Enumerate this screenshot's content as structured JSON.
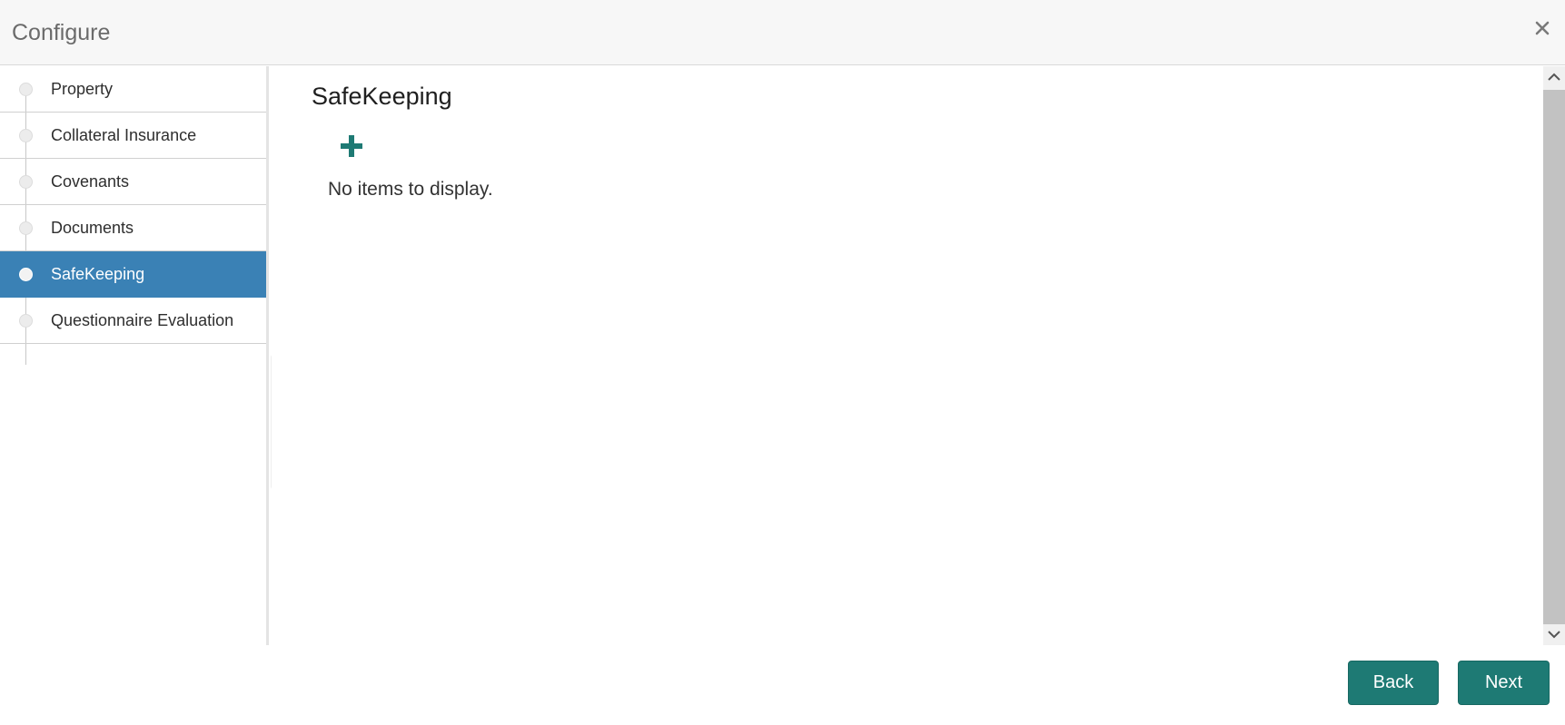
{
  "header": {
    "title": "Configure",
    "close_icon": "close-icon"
  },
  "sidebar": {
    "items": [
      {
        "label": "Property",
        "active": false
      },
      {
        "label": "Collateral Insurance",
        "active": false
      },
      {
        "label": "Covenants",
        "active": false
      },
      {
        "label": "Documents",
        "active": false
      },
      {
        "label": "SafeKeeping",
        "active": true
      },
      {
        "label": "Questionnaire Evaluation",
        "active": false
      }
    ]
  },
  "main": {
    "section_title": "SafeKeeping",
    "add_icon": "plus-icon",
    "empty_message": "No items to display."
  },
  "footer": {
    "back_label": "Back",
    "next_label": "Next"
  },
  "colors": {
    "active_step": "#3a81b5",
    "primary_button": "#1e7a74",
    "add_icon": "#1e7a74",
    "header_bg": "#f7f7f7"
  }
}
